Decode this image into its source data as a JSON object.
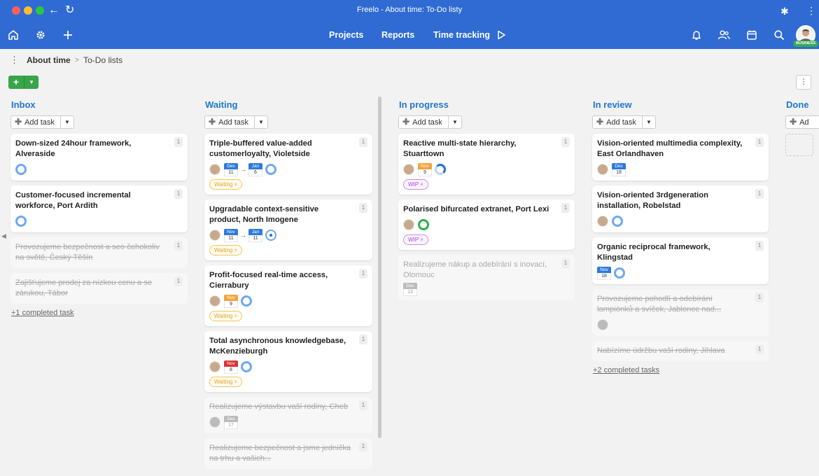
{
  "window": {
    "title": "Freelo - About time: To-Do listy"
  },
  "nav": {
    "links": [
      {
        "label": "Projects"
      },
      {
        "label": "Reports"
      },
      {
        "label": "Time tracking"
      }
    ],
    "badge": "BUSINESS"
  },
  "breadcrumb": {
    "project": "About time",
    "sep": ">",
    "current": "To-Do lists"
  },
  "common": {
    "add_task": "Add task",
    "add_task_short": "Ad"
  },
  "colors": {
    "brand": "#2f6bd3",
    "green": "#37a548",
    "link": "#1f77d0"
  },
  "columns": [
    {
      "title": "Inbox",
      "cards": [
        {
          "title": "Down-sized 24hour framework, Alveraside",
          "count": "1"
        },
        {
          "title": "Customer-focused incremental workforce, Port Ardith",
          "count": "1"
        },
        {
          "title": "Provozujeme bezpečnost a seo čehokoliv na světě, Český Těšín",
          "count": "1"
        },
        {
          "title": "Zajišťujeme prodej za nízkou cenu a se zárukou, Tábor",
          "count": "1"
        }
      ],
      "completed": "+1 completed task"
    },
    {
      "title": "Waiting",
      "cards": [
        {
          "title": "Triple-buffered value-added customerloyalty, Violetside",
          "count": "1",
          "d1m": "Dec",
          "d1d": "11",
          "d2m": "Jan",
          "d2d": "6",
          "tag": "Waiting"
        },
        {
          "title": "Upgradable context-sensitive product, North Imogene",
          "count": "1",
          "d1m": "Nov",
          "d1d": "11",
          "d2m": "Jan",
          "d2d": "11",
          "tag": "Waiting"
        },
        {
          "title": "Profit-focused real-time access, Cierrabury",
          "count": "1",
          "d1m": "Nov",
          "d1d": "9",
          "tag": "Waiting"
        },
        {
          "title": "Total asynchronous knowledgebase, McKenzieburgh",
          "count": "1",
          "d1m": "Nov",
          "d1d": "8",
          "tag": "Waiting"
        },
        {
          "title": "Realizujeme výstavbu vaší rodiny, Cheb",
          "count": "1",
          "d1m": "Dec",
          "d1d": "17"
        },
        {
          "title": "Realizujeme bezpečnost a jsme jednička na trhu a vašich...",
          "count": "1"
        }
      ]
    },
    {
      "title": "In progress",
      "cards": [
        {
          "title": "Reactive multi-state hierarchy, Stuarttown",
          "count": "1",
          "d1m": "Nov",
          "d1d": "9",
          "tag": "WIP"
        },
        {
          "title": "Polarised bifurcated extranet, Port Lexi",
          "count": "1",
          "tag": "WIP"
        },
        {
          "title": "Realizujeme nákup a odebírání s inovací, Olomouc",
          "count": "1",
          "d1m": "Dec",
          "d1d": "13"
        }
      ]
    },
    {
      "title": "In review",
      "cards": [
        {
          "title": "Vision-oriented multimedia complexity, East Orlandhaven",
          "count": "1",
          "d1m": "Dec",
          "d1d": "18"
        },
        {
          "title": "Vision-oriented 3rdgeneration installation, Robelstad",
          "count": "1"
        },
        {
          "title": "Organic reciprocal framework, Klingstad",
          "count": "1",
          "d1m": "Nov",
          "d1d": "18"
        },
        {
          "title": "Provozujeme pohodlí a odebírání lampiónků a svíček, Jablonec nad...",
          "count": "1"
        },
        {
          "title": "Nabízíme údržbu vaší rodiny, Jihlava",
          "count": "1"
        }
      ],
      "completed": "+2 completed tasks"
    },
    {
      "title": "Done"
    }
  ]
}
